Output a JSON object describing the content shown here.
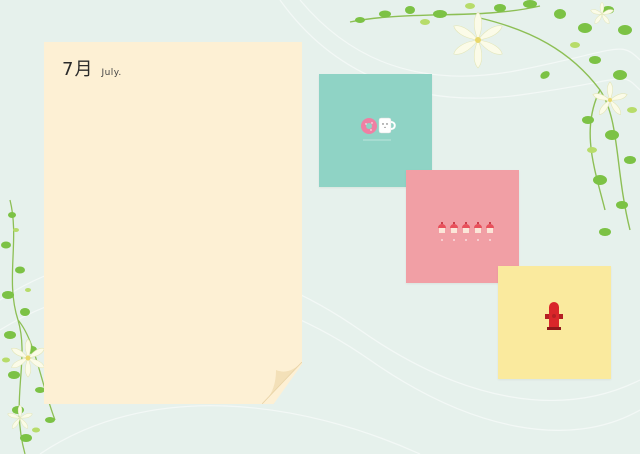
{
  "month_title": {
    "chinese": "7月",
    "english": "July."
  },
  "cards": [
    {
      "name": "donut-coffee-card",
      "color": "#8fd3c5",
      "icon": "donut-and-coffee-mug-icon"
    },
    {
      "name": "cupcakes-card",
      "color": "#f19fa5",
      "icon": "five-cupcakes-icon"
    },
    {
      "name": "fire-hydrant-card",
      "color": "#faea9e",
      "icon": "fire-hydrant-icon"
    }
  ],
  "colors": {
    "background": "#e6f1ec",
    "paper": "#fdf0d4",
    "leaf_green": "#7cc245",
    "flower_white": "#fbfbe8"
  },
  "decorations": [
    "ivy-vine-top-right",
    "ivy-vine-bottom-left",
    "white-lily-flowers"
  ]
}
